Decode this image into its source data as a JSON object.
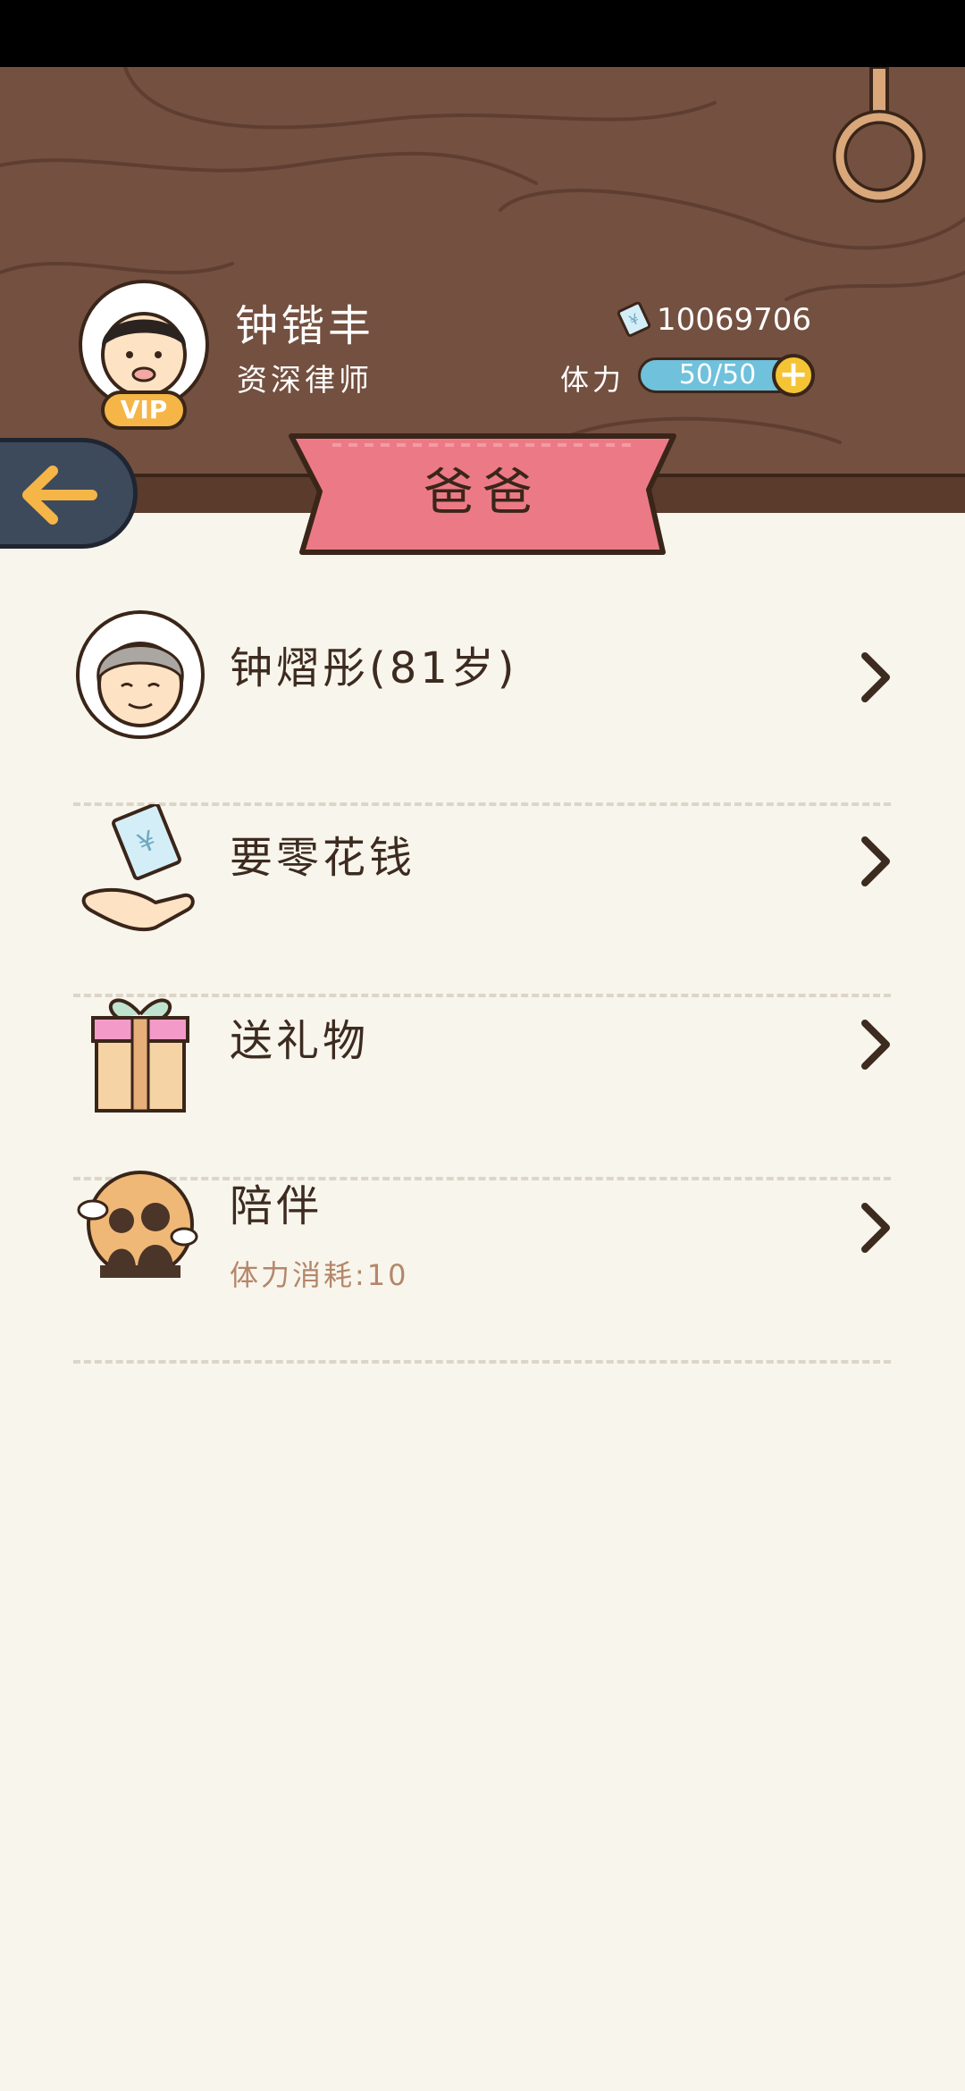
{
  "player": {
    "name": "钟锴丰",
    "title": "资深律师",
    "vip_label": "VIP",
    "money": "10069706",
    "stamina_label": "体力",
    "stamina_value": "50/50",
    "stamina_fraction": 1.0
  },
  "page": {
    "title": "爸爸"
  },
  "rows": [
    {
      "label": "钟熠彤(81岁)",
      "icon": "grandpa-avatar-icon"
    },
    {
      "label": "要零花钱",
      "icon": "money-hand-icon"
    },
    {
      "label": "送礼物",
      "icon": "gift-box-icon"
    },
    {
      "label": "陪伴",
      "sub": "体力消耗:10",
      "icon": "companion-icon"
    }
  ],
  "colors": {
    "header_wood": "#745040",
    "background": "#f8f5ec",
    "ribbon": "#ec7a86",
    "stamina_bar": "#6fc1dc",
    "vip_badge": "#f5b547",
    "back_button": "#3d4a5c"
  }
}
